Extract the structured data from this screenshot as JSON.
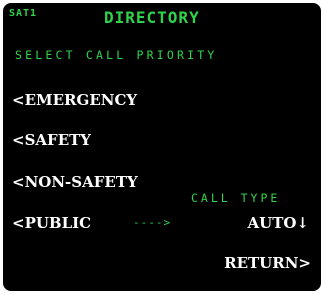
{
  "header": {
    "page_ref": "SAT1",
    "title": "DIRECTORY"
  },
  "subtitle": "SELECT CALL PRIORITY",
  "left_keys": [
    {
      "label": "<EMERGENCY"
    },
    {
      "label": "<SAFETY"
    },
    {
      "label": "<NON-SAFETY"
    },
    {
      "label": "<PUBLIC"
    }
  ],
  "public_arrow": "---->",
  "call_type": {
    "label": "CALL TYPE",
    "value": "AUTO↓"
  },
  "return_label": "RETURN>",
  "colors": {
    "background": "#000000",
    "label_green": "#31d24a",
    "text_white": "#ffffff"
  }
}
